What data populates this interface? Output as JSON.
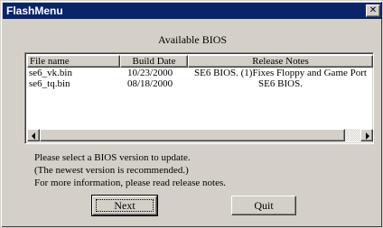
{
  "window": {
    "title": "FlashMenu",
    "close_glyph": "✕"
  },
  "main": {
    "heading": "Available BIOS"
  },
  "bios_list": {
    "columns": [
      "File name",
      "Build Date",
      "Release Notes"
    ],
    "rows": [
      [
        "se6_vk.bin",
        "10/23/2000",
        "SE6 BIOS. (1)Fixes Floppy and Game Port"
      ],
      [
        "se6_tq.bin",
        "08/18/2000",
        "SE6 BIOS."
      ]
    ]
  },
  "messages": [
    "Please select a BIOS version to update.",
    "(The newest version is recommended.)",
    "For more information, please read release notes."
  ],
  "buttons": {
    "next_label": "Next",
    "quit_label": "Quit"
  },
  "colors": {
    "title_bar": "#0a246a",
    "face": "#d4d0c8"
  }
}
